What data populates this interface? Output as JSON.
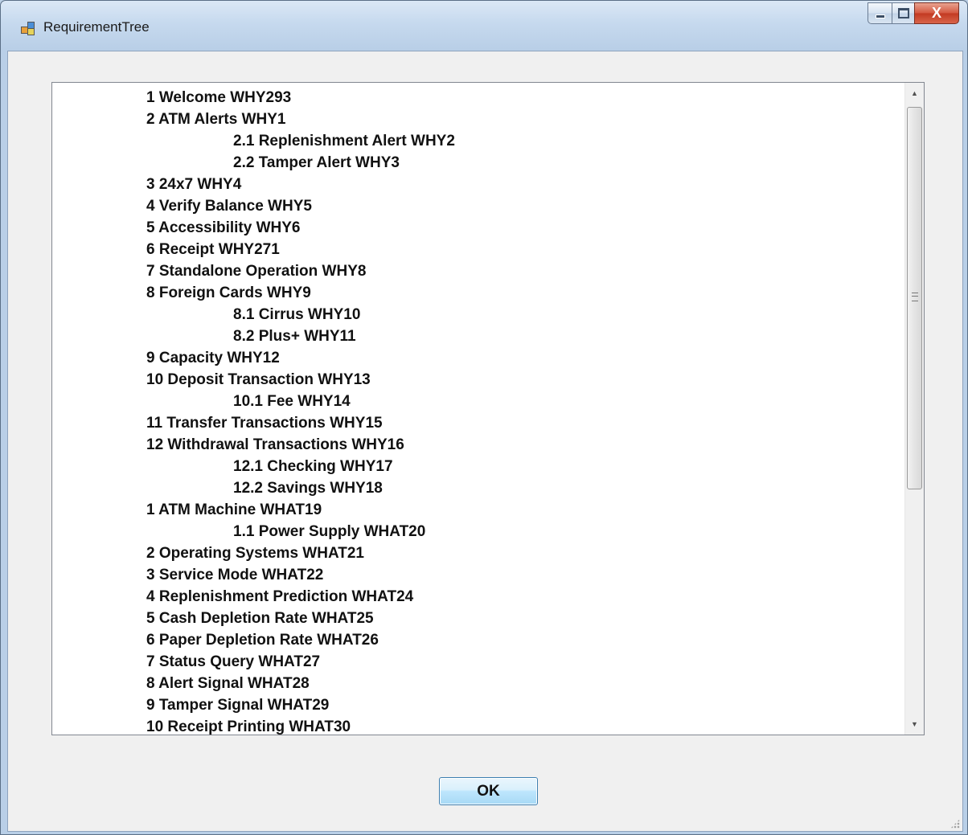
{
  "window": {
    "title": "RequirementTree",
    "close_glyph": "X"
  },
  "list": {
    "items": [
      {
        "text": "1 Welcome WHY293",
        "level": 0
      },
      {
        "text": "2 ATM Alerts WHY1",
        "level": 0
      },
      {
        "text": "2.1 Replenishment Alert WHY2",
        "level": 1
      },
      {
        "text": "2.2 Tamper Alert WHY3",
        "level": 1
      },
      {
        "text": "3 24x7 WHY4",
        "level": 0
      },
      {
        "text": "4 Verify Balance WHY5",
        "level": 0
      },
      {
        "text": "5 Accessibility WHY6",
        "level": 0
      },
      {
        "text": "6 Receipt WHY271",
        "level": 0
      },
      {
        "text": "7 Standalone Operation WHY8",
        "level": 0
      },
      {
        "text": "8 Foreign Cards WHY9",
        "level": 0
      },
      {
        "text": "8.1 Cirrus WHY10",
        "level": 1
      },
      {
        "text": "8.2 Plus+ WHY11",
        "level": 1
      },
      {
        "text": "9 Capacity WHY12",
        "level": 0
      },
      {
        "text": "10 Deposit Transaction WHY13",
        "level": 0
      },
      {
        "text": "10.1 Fee WHY14",
        "level": 1
      },
      {
        "text": "11 Transfer Transactions WHY15",
        "level": 0
      },
      {
        "text": "12 Withdrawal Transactions WHY16",
        "level": 0
      },
      {
        "text": "12.1 Checking WHY17",
        "level": 1
      },
      {
        "text": "12.2 Savings WHY18",
        "level": 1
      },
      {
        "text": "1 ATM Machine WHAT19",
        "level": 0
      },
      {
        "text": "1.1 Power Supply WHAT20",
        "level": 1
      },
      {
        "text": "2 Operating Systems WHAT21",
        "level": 0
      },
      {
        "text": "3 Service Mode WHAT22",
        "level": 0
      },
      {
        "text": "4 Replenishment Prediction WHAT24",
        "level": 0
      },
      {
        "text": "5 Cash Depletion Rate WHAT25",
        "level": 0
      },
      {
        "text": "6 Paper Depletion Rate WHAT26",
        "level": 0
      },
      {
        "text": "7 Status Query WHAT27",
        "level": 0
      },
      {
        "text": "8 Alert Signal WHAT28",
        "level": 0
      },
      {
        "text": "9 Tamper Signal WHAT29",
        "level": 0
      },
      {
        "text": "10 Receipt Printing WHAT30",
        "level": 0
      }
    ]
  },
  "buttons": {
    "ok_label": "OK"
  }
}
